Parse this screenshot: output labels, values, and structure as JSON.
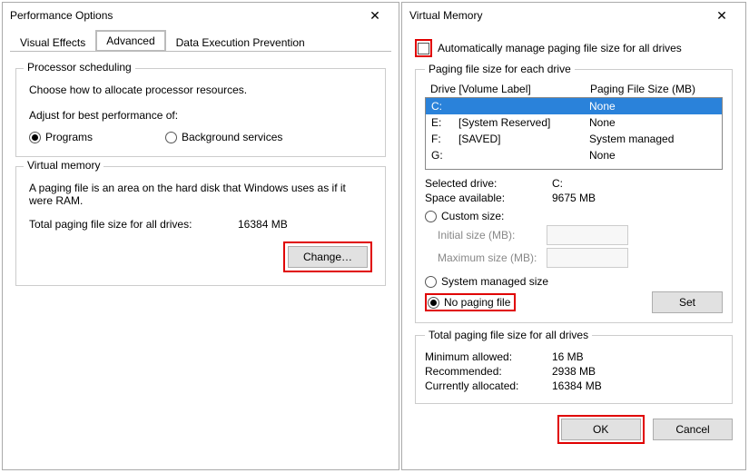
{
  "perf": {
    "title": "Performance Options",
    "tabs": {
      "vis": "Visual Effects",
      "adv": "Advanced",
      "dep": "Data Execution Prevention"
    },
    "ps": {
      "legend": "Processor scheduling",
      "intro": "Choose how to allocate processor resources.",
      "adjust": "Adjust for best performance of:",
      "programs": "Programs",
      "bg": "Background services"
    },
    "vm": {
      "legend": "Virtual memory",
      "desc": "A paging file is an area on the hard disk that Windows uses as if it were RAM.",
      "total_lbl": "Total paging file size for all drives:",
      "total_val": "16384 MB",
      "change": "Change…"
    }
  },
  "vmem": {
    "title": "Virtual Memory",
    "auto": "Automatically manage paging file size for all drives",
    "pfs_legend": "Paging file size for each drive",
    "hdr_drive": "Drive  [Volume Label]",
    "hdr_size": "Paging File Size (MB)",
    "drives": [
      {
        "d": "C:",
        "label": "",
        "size": "None"
      },
      {
        "d": "E:",
        "label": "[System Reserved]",
        "size": "None"
      },
      {
        "d": "F:",
        "label": "[SAVED]",
        "size": "System managed"
      },
      {
        "d": "G:",
        "label": "",
        "size": "None"
      }
    ],
    "seldrive_lbl": "Selected drive:",
    "seldrive_val": "C:",
    "space_lbl": "Space available:",
    "space_val": "9675 MB",
    "custom": "Custom size:",
    "init": "Initial size (MB):",
    "max": "Maximum size (MB):",
    "sysman": "System managed size",
    "nopage": "No paging file",
    "set": "Set",
    "totals_legend": "Total paging file size for all drives",
    "min_lbl": "Minimum allowed:",
    "min_val": "16 MB",
    "rec_lbl": "Recommended:",
    "rec_val": "2938 MB",
    "cur_lbl": "Currently allocated:",
    "cur_val": "16384 MB",
    "ok": "OK",
    "cancel": "Cancel"
  }
}
